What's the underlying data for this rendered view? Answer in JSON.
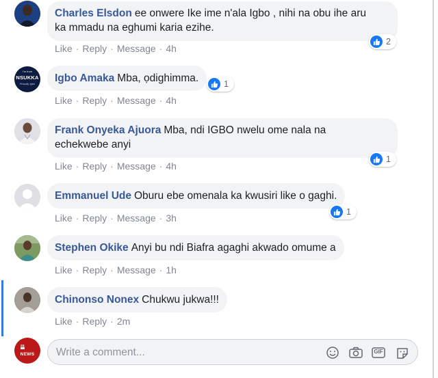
{
  "comments": [
    {
      "author": "Charles Elsdon",
      "text_lines": [
        "ee onwere Ike ime n'ala Igbo , nihi na obu ihe aru",
        "ka mmadu na eghumi karia ezihe."
      ],
      "actions": {
        "like": "Like",
        "reply": "Reply",
        "message": "Message",
        "time": "4h"
      },
      "reactions": "2"
    },
    {
      "author": "Igbo Amaka",
      "text_lines": [
        "Mba, ọdighimma."
      ],
      "actions": {
        "like": "Like",
        "reply": "Reply",
        "message": "Message",
        "time": "4h"
      },
      "reactions": "1",
      "avatar_text": {
        "top": "I'm from",
        "main": "NSUKKA",
        "sub": "Proudly Igbo"
      }
    },
    {
      "author": "Frank Onyeka Ajuora",
      "text_lines": [
        "Mba, ndi IGBO nwelu ome nala na",
        "echekwebe anyi"
      ],
      "actions": {
        "like": "Like",
        "reply": "Reply",
        "message": "Message",
        "time": "4h"
      },
      "reactions": "1"
    },
    {
      "author": "Emmanuel Ude",
      "text_lines": [
        "Oburu ebe omenala ka kwusiri like o gaghi."
      ],
      "actions": {
        "like": "Like",
        "reply": "Reply",
        "message": "Message",
        "time": "3h"
      },
      "reactions": "1"
    },
    {
      "author": "Stephen Okike",
      "text_lines": [
        "Anyi bu ndi Biafra agaghi akwado omume a"
      ],
      "actions": {
        "like": "Like",
        "reply": "Reply",
        "message": "Message",
        "time": "1h"
      }
    },
    {
      "author": "Chinonso Nonex",
      "text_lines": [
        "Chukwu jukwa!!!"
      ],
      "actions": {
        "like": "Like",
        "reply": "Reply",
        "time": "2m"
      }
    }
  ],
  "composer": {
    "placeholder": "Write a comment...",
    "avatar_logo": [
      "BBC",
      "NEWS"
    ],
    "icons": [
      "emoji-icon",
      "camera-icon",
      "gif-icon",
      "sticker-icon"
    ],
    "gif_label": "GIF"
  },
  "colors": {
    "author": "#385898",
    "bubble": "#f2f3f5",
    "like_blue": "#1877f2",
    "meta": "#7f8791",
    "bbc_red": "#bb1919"
  }
}
